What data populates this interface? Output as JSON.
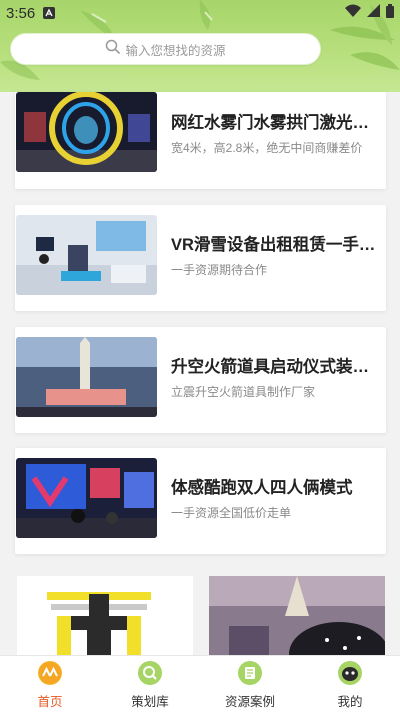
{
  "status_bar": {
    "time": "3:56"
  },
  "search": {
    "placeholder": "输入您想找的资源"
  },
  "list": [
    {
      "title": "网红水雾门水雾拱门激光…",
      "subtitle": "宽4米，高2.8米，绝无中间商赚差价"
    },
    {
      "title": "VR滑雪设备出租租赁一手…",
      "subtitle": "一手资源期待合作"
    },
    {
      "title": "升空火箭道具启动仪式装…",
      "subtitle": "立震升空火箭道具制作厂家"
    },
    {
      "title": "体感酷跑双人四人俩模式",
      "subtitle": "一手资源全国低价走单"
    }
  ],
  "nav": {
    "items": [
      {
        "label": "首页",
        "icon": "home-icon",
        "active": true
      },
      {
        "label": "策划库",
        "icon": "search-icon",
        "active": false
      },
      {
        "label": "资源案例",
        "icon": "document-icon",
        "active": false
      },
      {
        "label": "我的",
        "icon": "profile-icon",
        "active": false
      }
    ]
  },
  "colors": {
    "header_green": "#b2dc76",
    "active_orange": "#e55a24",
    "nav_icon_green": "#9ccf4f"
  }
}
